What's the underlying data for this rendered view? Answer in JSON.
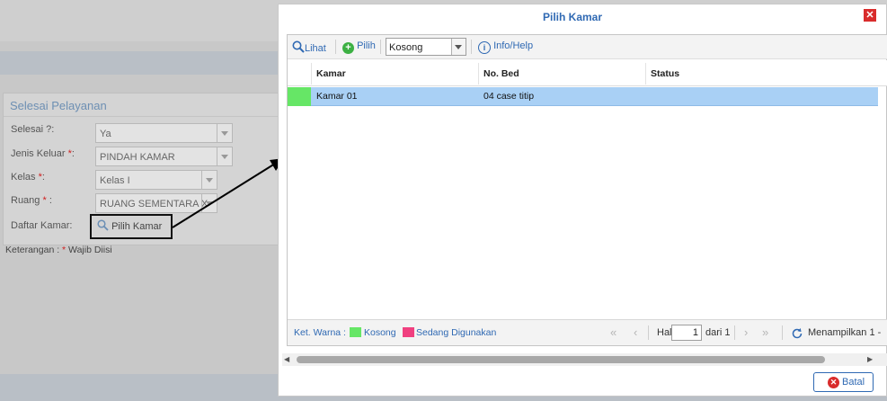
{
  "background_form": {
    "panel_title": "Selesai Pelayanan",
    "fields": [
      {
        "label": "Selesai ?:",
        "required": false,
        "value": "Ya"
      },
      {
        "label": "Jenis Keluar ",
        "required": true,
        "suffix": ":",
        "value": "PINDAH KAMAR"
      },
      {
        "label": "Kelas ",
        "required": true,
        "suffix": ":",
        "value": "Kelas I"
      },
      {
        "label": "Ruang ",
        "required": true,
        "suffix": " :",
        "value": "RUANG SEMENTARA X"
      },
      {
        "label": "Daftar Kamar:",
        "required": false,
        "value": ""
      }
    ],
    "pick_room_button": "Pilih Kamar",
    "note_prefix": "Keterangan : ",
    "note_star": "*",
    "note_suffix": " Wajib Diisi"
  },
  "dialog": {
    "title": "Pilih Kamar",
    "close_icon": "close-x-icon",
    "toolbar": {
      "view_label": "Lihat",
      "select_label": "Pilih",
      "filter_value": "Kosong",
      "help_label": "Info/Help"
    },
    "columns": [
      "Kamar",
      "No. Bed",
      "Status"
    ],
    "rows": [
      {
        "kamar": "Kamar 01",
        "no_bed": "04 case titip",
        "status": "",
        "color": "#66e666"
      }
    ],
    "legend": {
      "label": "Ket. Warna :",
      "items": [
        {
          "label": "Kosong",
          "color": "#66e666"
        },
        {
          "label": "Sedang Digunakan",
          "color": "#f04080"
        }
      ]
    },
    "pager": {
      "page_label": "Hal",
      "page_value": "1",
      "of_label": "dari 1",
      "display_text": "Menampilkan 1 -"
    },
    "cancel_button": "Batal"
  },
  "colors": {
    "accent": "#2f69b3",
    "selected_row": "#a9d0f5",
    "close": "#d92c2c"
  }
}
